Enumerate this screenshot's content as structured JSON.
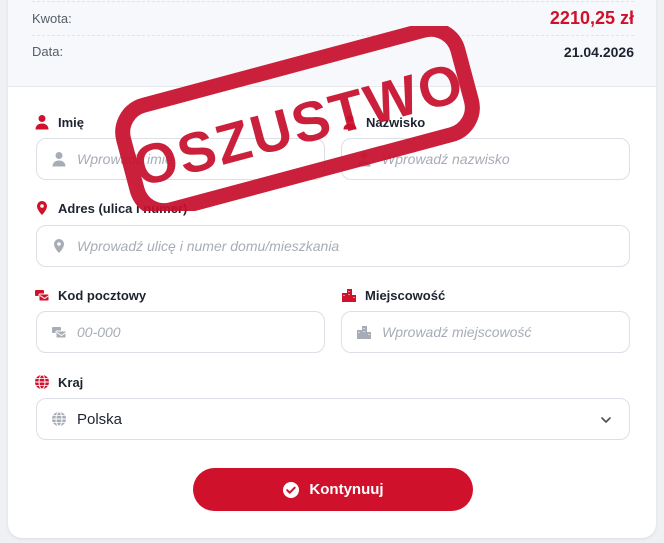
{
  "summary": {
    "amount_label": "Kwota:",
    "amount_value": "2210,25 zł",
    "date_label": "Data:",
    "date_value": "21.04.2026"
  },
  "form": {
    "first_name": {
      "label": "Imię",
      "placeholder": "Wprowadź imię",
      "icon": "user-icon"
    },
    "last_name": {
      "label": "Nazwisko",
      "placeholder": "Wprowadź nazwisko",
      "icon": "user-icon"
    },
    "address": {
      "label": "Adres (ulica i numer)",
      "placeholder": "Wprowadź ulicę i numer domu/mieszkania",
      "icon": "map-pin-icon"
    },
    "postal_code": {
      "label": "Kod pocztowy",
      "placeholder": "00-000",
      "icon": "mail-bulk-icon"
    },
    "city": {
      "label": "Miejscowość",
      "placeholder": "Wprowadź miejscowość",
      "icon": "city-icon"
    },
    "country": {
      "label": "Kraj",
      "value": "Polska",
      "icon": "globe-icon"
    }
  },
  "submit": {
    "label": "Kontynuuj",
    "icon": "check-circle-icon"
  },
  "stamp": {
    "text": "OSZUSTWO"
  },
  "colors": {
    "accent": "#d0112b",
    "icon_muted": "#a7adb6",
    "border": "#dcdfe5",
    "text": "#1d2330"
  }
}
